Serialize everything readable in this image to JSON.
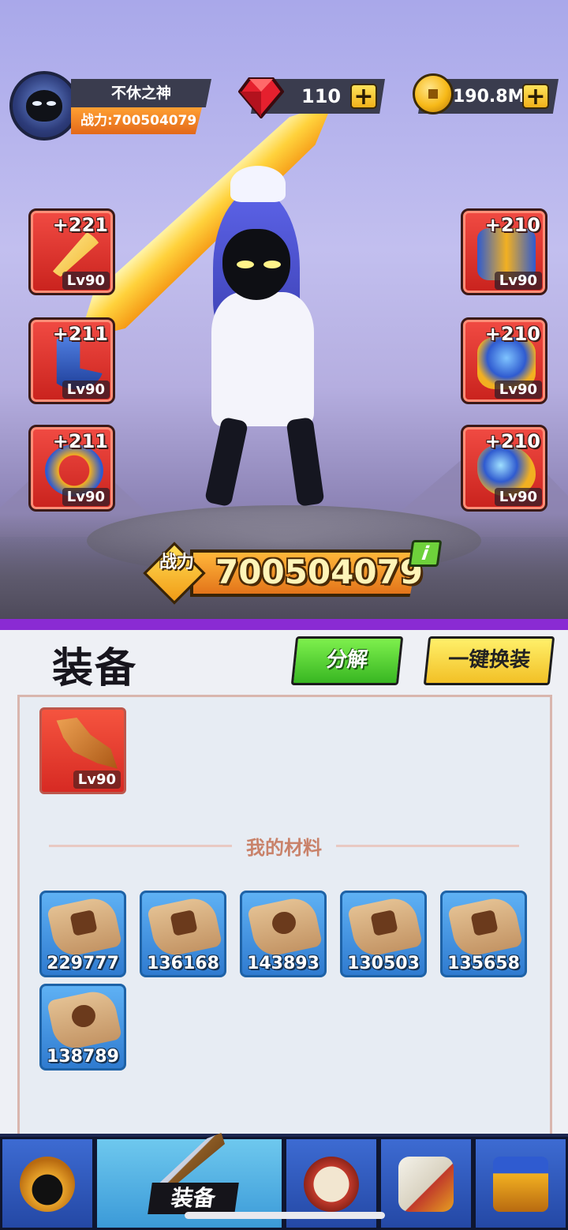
{
  "player": {
    "name": "不休之神",
    "power_text": "战力:700504079"
  },
  "currencies": {
    "gems": "110",
    "gold": "190.8M",
    "plus_symbol": "+"
  },
  "equipped": {
    "left": [
      {
        "bonus": "+221",
        "level": "Lv90",
        "color": "#f0c040"
      },
      {
        "bonus": "+211",
        "level": "Lv90",
        "color": "#3f6fd8"
      },
      {
        "bonus": "+211",
        "level": "Lv90",
        "color": "#2f5bd0"
      }
    ],
    "right": [
      {
        "bonus": "+210",
        "level": "Lv90",
        "color": "#3a66d6"
      },
      {
        "bonus": "+210",
        "level": "Lv90",
        "color": "#3a66d6"
      },
      {
        "bonus": "+210",
        "level": "Lv90",
        "color": "#3a66d6"
      }
    ]
  },
  "combat_power": {
    "label": "战力",
    "value": "700504079",
    "info_symbol": "i"
  },
  "panel": {
    "title": "装备",
    "decompose_label": "分解",
    "auto_equip_label": "一键换装",
    "inventory_item": {
      "level": "Lv90"
    },
    "materials_label": "我的材料",
    "materials": [
      "229777",
      "136168",
      "143893",
      "130503",
      "135658",
      "138789"
    ]
  },
  "nav": {
    "active_label": "装备"
  },
  "colors": {
    "accent_purple": "#8a2bd3",
    "button_green": "#38b622",
    "button_yellow": "#f2c026",
    "slot_red": "#d72a23",
    "material_blue": "#2f7bd0"
  }
}
